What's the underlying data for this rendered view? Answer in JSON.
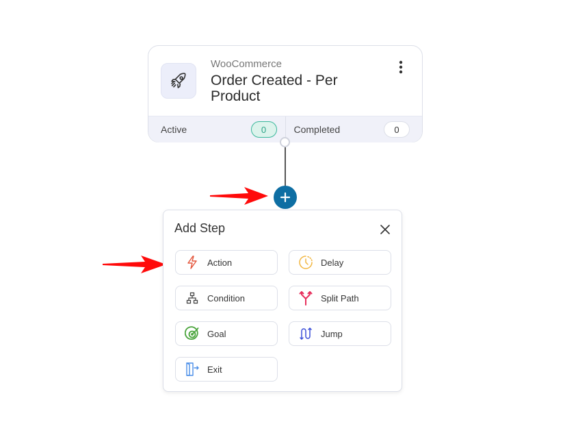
{
  "trigger": {
    "provider": "WooCommerce",
    "title": "Order Created - Per Product",
    "icon": "rocket-icon",
    "menu_icon": "more-vertical-icon",
    "stats": [
      {
        "label": "Active",
        "value": "0"
      },
      {
        "label": "Completed",
        "value": "0"
      }
    ]
  },
  "add_button": {
    "icon": "plus-icon"
  },
  "panel": {
    "title": "Add Step",
    "close_icon": "close-icon",
    "steps": [
      {
        "label": "Action",
        "icon": "lightning-icon",
        "color": "#e4573d"
      },
      {
        "label": "Delay",
        "icon": "clock-icon",
        "color": "#f2b640"
      },
      {
        "label": "Condition",
        "icon": "hierarchy-icon",
        "color": "#444444"
      },
      {
        "label": "Split Path",
        "icon": "split-icon",
        "color": "#e62e5c"
      },
      {
        "label": "Goal",
        "icon": "target-icon",
        "color": "#4aa43c"
      },
      {
        "label": "Jump",
        "icon": "jump-icon",
        "color": "#3b4ed8"
      },
      {
        "label": "Exit",
        "icon": "exit-door-icon",
        "color": "#4a8ee8"
      }
    ]
  },
  "colors": {
    "accent": "#0e6ea3",
    "active_pill": "#38b79a",
    "annotation_arrow": "#ff0000"
  }
}
